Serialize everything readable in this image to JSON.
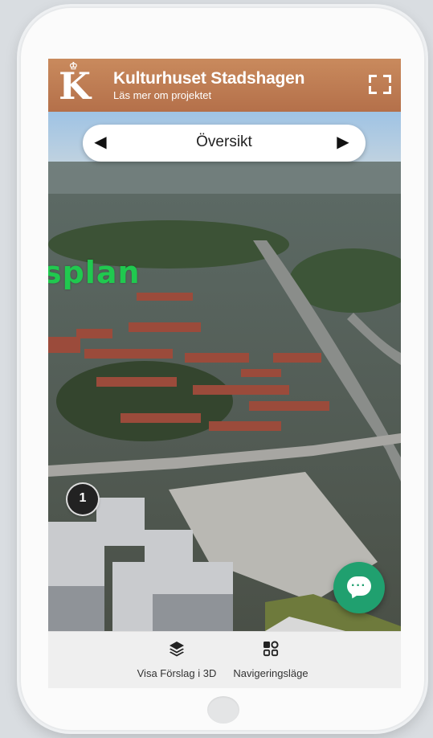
{
  "header": {
    "logo_letter": "K",
    "title": "Kulturhuset Stadshagen",
    "subtitle": "Läs mer om projektet"
  },
  "scene_nav": {
    "prev": "◀",
    "label": "Översikt",
    "next": "▶"
  },
  "map": {
    "place_label": "splan",
    "marker_number": "1"
  },
  "bottom_bar": {
    "items": [
      {
        "label": "Visa Förslag i 3D",
        "icon": "layers-icon"
      },
      {
        "label": "Navigeringsläge",
        "icon": "grid-icon"
      }
    ]
  },
  "colors": {
    "header": "#c07d52",
    "chat_button": "#20a06f",
    "place_label": "#20c94f"
  }
}
